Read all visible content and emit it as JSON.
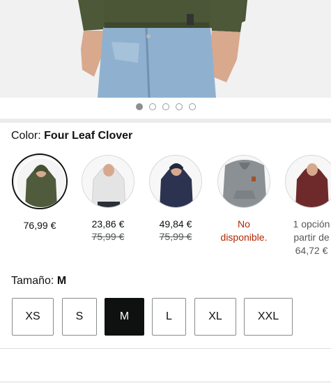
{
  "carousel": {
    "dots": [
      true,
      false,
      false,
      false,
      false
    ]
  },
  "color": {
    "label": "Color:",
    "value": "Four Leaf Clover"
  },
  "swatches": [
    {
      "name": "green",
      "color": "#4f5b3c",
      "price": "76,99 €",
      "list_price": "",
      "selected": true
    },
    {
      "name": "white",
      "color": "#e9e9e9",
      "price": "23,86 €",
      "list_price": "75,99 €"
    },
    {
      "name": "navy",
      "color": "#2b3350",
      "price": "49,84 €",
      "list_price": "75,99 €"
    },
    {
      "name": "grey",
      "color": "#8b9095",
      "status_line1": "No",
      "status_line2": "disponible."
    },
    {
      "name": "burgundy",
      "color": "#6e2a2a",
      "options_line1": "1 opción",
      "options_line2": "partir de",
      "options_line3": "64,72 €"
    }
  ],
  "size": {
    "label": "Tamaño:",
    "value": "M"
  },
  "sizes": [
    {
      "label": "XS"
    },
    {
      "label": "S"
    },
    {
      "label": "M",
      "selected": true
    },
    {
      "label": "L"
    },
    {
      "label": "XL"
    },
    {
      "label": "XXL"
    }
  ],
  "colors": {
    "accent_red": "#b12704",
    "selected_bg": "#0f1111"
  }
}
